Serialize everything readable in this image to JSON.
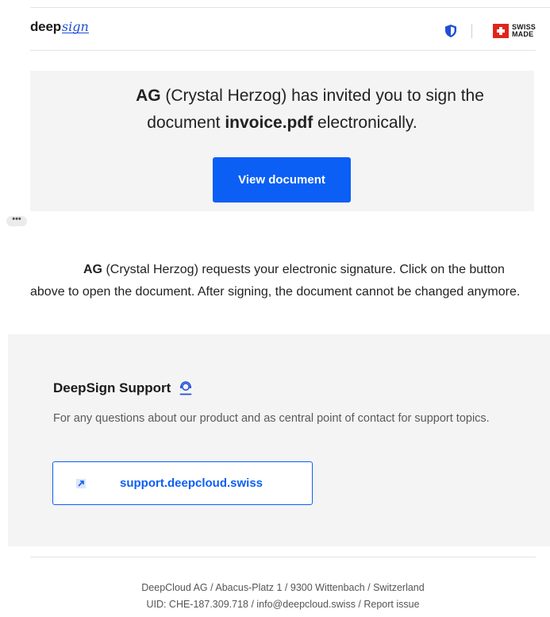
{
  "header": {
    "logo_deep": "deep",
    "logo_sign": "sign",
    "swiss_line1": "SWISS",
    "swiss_line2": "MADE"
  },
  "invite": {
    "sender_bold": "AG",
    "sender_rest": " (Crystal Herzog) has invited you to sign the",
    "line2_pre": "document ",
    "document_name": "invoice.pdf",
    "line2_post": " electronically.",
    "button_label": "View document"
  },
  "ellipsis": "•••",
  "body": {
    "sender_bold": "AG",
    "text": " (Crystal Herzog) requests your electronic signature. Click on the button above to open the document. After signing, the document cannot be changed anymore."
  },
  "support": {
    "title": "DeepSign Support",
    "description": "For any questions about our product and as central point of contact for support topics.",
    "link_label": "support.deepcloud.swiss",
    "icons": {
      "title_icon": "support-agent-icon",
      "link_icon": "external-link-arrow-icon"
    }
  },
  "footer": {
    "line1": "DeepCloud AG / Abacus-Platz 1 / 9300 Wittenbach / Switzerland",
    "line2": "UID: CHE-187.309.718 / info@deepcloud.swiss / Report issue"
  },
  "colors": {
    "accent": "#0b5ff5",
    "panel_bg": "#f4f4f4",
    "swiss_red": "#e1251b"
  }
}
